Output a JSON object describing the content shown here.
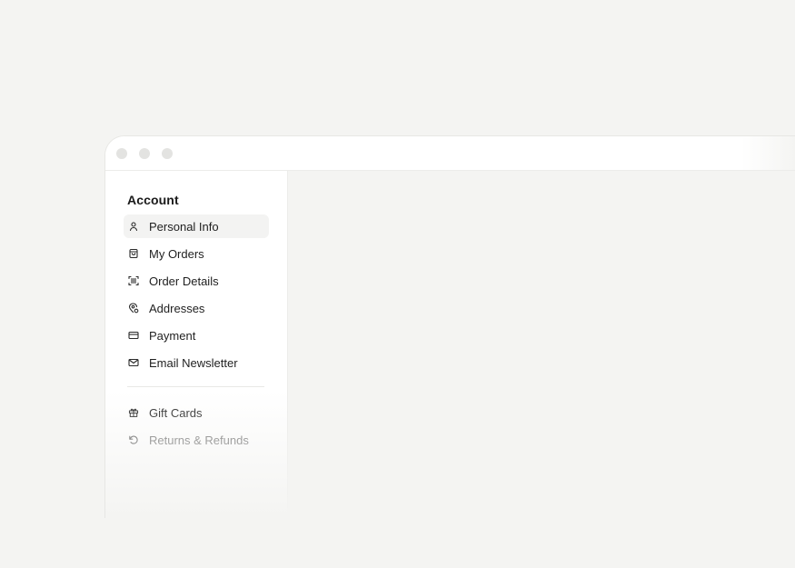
{
  "window": {
    "controls": [
      "close",
      "minimize",
      "maximize"
    ]
  },
  "sidebar": {
    "section_title": "Account",
    "items": [
      {
        "label": "Personal Info",
        "icon": "user-icon",
        "active": true
      },
      {
        "label": "My Orders",
        "icon": "shopping-bag-icon",
        "active": false
      },
      {
        "label": "Order Details",
        "icon": "barcode-scan-icon",
        "active": false
      },
      {
        "label": "Addresses",
        "icon": "location-pin-icon",
        "active": false
      },
      {
        "label": "Payment",
        "icon": "credit-card-icon",
        "active": false
      },
      {
        "label": "Email Newsletter",
        "icon": "mail-icon",
        "active": false
      }
    ],
    "secondary_items": [
      {
        "label": "Gift Cards",
        "icon": "gift-icon"
      },
      {
        "label": "Returns & Refunds",
        "icon": "return-icon"
      }
    ]
  },
  "colors": {
    "background": "#f4f4f2",
    "window": "#ffffff",
    "active_item": "#f3f3f2",
    "text": "#1a1a1a",
    "muted_text": "#6b6b6b"
  }
}
